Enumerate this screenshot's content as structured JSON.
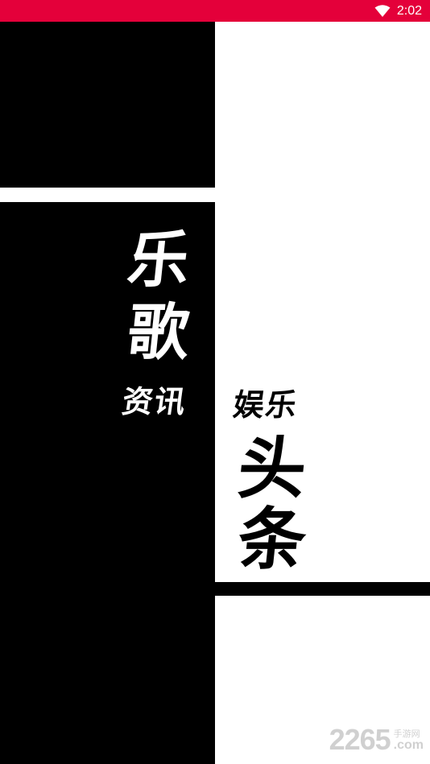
{
  "status_bar": {
    "time": "2:02",
    "wifi_icon": "wifi-icon",
    "background_color": "#e4003a"
  },
  "splash": {
    "title_chars": [
      "乐",
      "歌"
    ],
    "subtitle_left": "资讯",
    "subtitle_right": "娱乐",
    "headline_chars": [
      "头",
      "条"
    ]
  },
  "watermark": {
    "number": "2265",
    "cn_label": "手游网",
    "domain_suffix": ".com"
  },
  "colors": {
    "accent": "#e4003a",
    "black": "#000000",
    "white": "#ffffff"
  }
}
